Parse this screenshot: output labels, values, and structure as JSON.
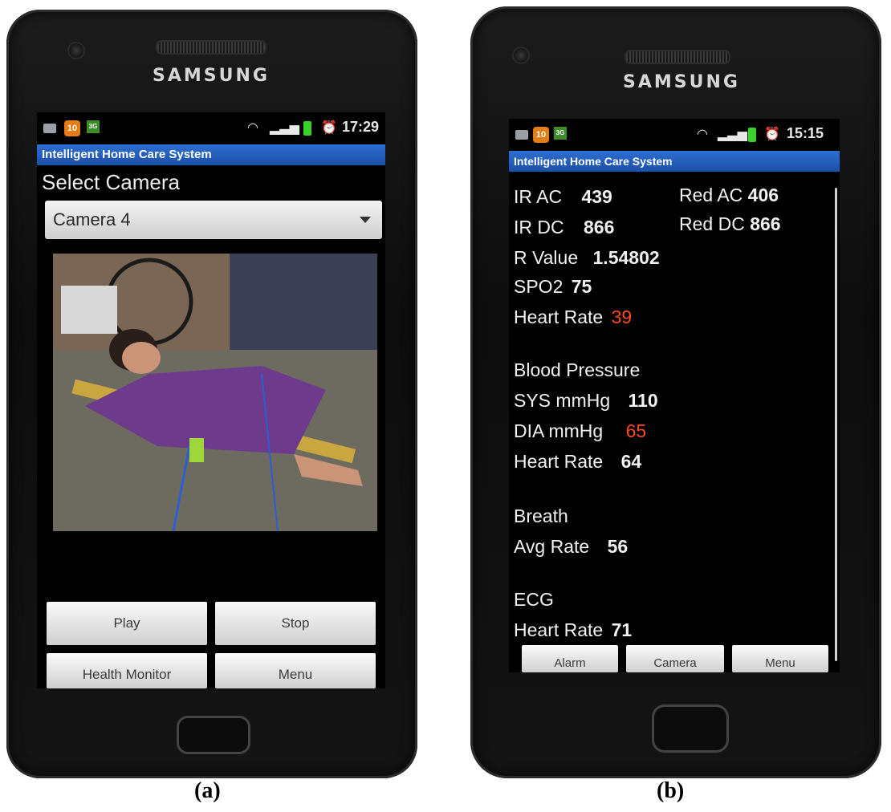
{
  "figure_a": {
    "brand": "SAMSUNG",
    "status": {
      "time": "17:29",
      "badge": "10",
      "network": "3G"
    },
    "app_title": "Intelligent Home Care System",
    "select_label": "Select Camera",
    "camera_dropdown": {
      "selected": "Camera 4"
    },
    "buttons": {
      "play": "Play",
      "stop": "Stop",
      "health_monitor": "Health Monitor",
      "menu": "Menu"
    },
    "caption": "(a)"
  },
  "figure_b": {
    "brand": "SAMSUNG",
    "status": {
      "time": "15:15",
      "badge": "10",
      "network": "3G"
    },
    "app_title": "Intelligent Home Care System",
    "spo2_section": {
      "ir_ac_label": "IR AC",
      "ir_ac_value": "439",
      "red_ac_label": "Red AC",
      "red_ac_value": "406",
      "ir_dc_label": "IR DC",
      "ir_dc_value": "866",
      "red_dc_label": "Red DC",
      "red_dc_value": "866",
      "r_value_label": "R Value",
      "r_value": "1.54802",
      "spo2_label": "SPO2",
      "spo2_value": "75",
      "heart_rate_label": "Heart Rate",
      "heart_rate_value": "39"
    },
    "blood_pressure": {
      "title": "Blood Pressure",
      "sys_label": "SYS mmHg",
      "sys_value": "110",
      "dia_label": "DIA mmHg",
      "dia_value": "65",
      "heart_rate_label": "Heart Rate",
      "heart_rate_value": "64"
    },
    "breath": {
      "title": "Breath",
      "avg_label": "Avg Rate",
      "avg_value": "56"
    },
    "ecg": {
      "title": "ECG",
      "heart_rate_label": "Heart Rate",
      "heart_rate_value": "71"
    },
    "buttons": {
      "alarm": "Alarm",
      "camera": "Camera",
      "menu": "Menu"
    },
    "caption": "(b)"
  },
  "colors": {
    "title_bar": "#1c4fa8",
    "alert_value": "#ff4a1e",
    "battery": "#3ad12c"
  }
}
